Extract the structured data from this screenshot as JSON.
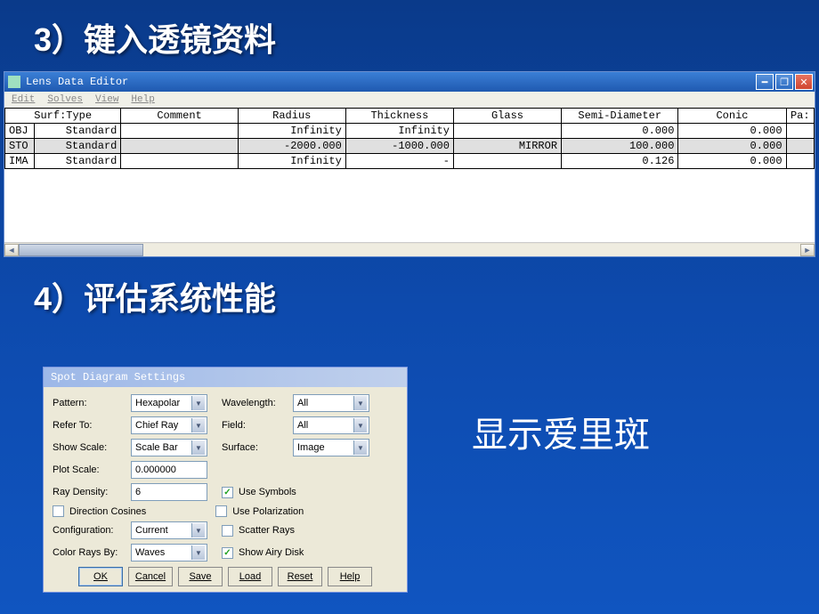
{
  "headings": {
    "h1": "3）键入透镜资料",
    "h2": "4）评估系统性能"
  },
  "lensWindow": {
    "title": "Lens Data Editor",
    "menu": [
      "Edit",
      "Solves",
      "View",
      "Help"
    ],
    "columns": [
      "Surf:Type",
      "Comment",
      "Radius",
      "Thickness",
      "Glass",
      "Semi-Diameter",
      "Conic",
      "Pa:"
    ],
    "rows": [
      {
        "id": "OBJ",
        "type": "Standard",
        "comment": "",
        "radius": "Infinity",
        "thickness": "Infinity",
        "glass": "",
        "semid": "0.000",
        "conic": "0.000"
      },
      {
        "id": "STO",
        "type": "Standard",
        "comment": "",
        "radius": "-2000.000",
        "thickness": "-1000.000",
        "glass": "MIRROR",
        "semid": "100.000",
        "conic": "0.000"
      },
      {
        "id": "IMA",
        "type": "Standard",
        "comment": "",
        "radius": "Infinity",
        "thickness": "-",
        "glass": "",
        "semid": "0.126",
        "conic": "0.000"
      }
    ]
  },
  "dialog": {
    "title": "Spot Diagram Settings",
    "labels": {
      "pattern": "Pattern:",
      "referTo": "Refer To:",
      "showScale": "Show Scale:",
      "plotScale": "Plot Scale:",
      "rayDensity": "Ray Density:",
      "wavelength": "Wavelength:",
      "field": "Field:",
      "surface": "Surface:",
      "configuration": "Configuration:",
      "colorRaysBy": "Color Rays By:"
    },
    "values": {
      "pattern": "Hexapolar",
      "referTo": "Chief Ray",
      "showScale": "Scale Bar",
      "plotScale": "0.000000",
      "rayDensity": "6",
      "wavelength": "All",
      "field": "All",
      "surface": "Image",
      "configuration": "Current",
      "colorRaysBy": "Waves"
    },
    "checks": {
      "dirCos": {
        "label": "Direction Cosines",
        "checked": false
      },
      "useSym": {
        "label": "Use Symbols",
        "checked": true
      },
      "usePol": {
        "label": "Use Polarization",
        "checked": false
      },
      "scatter": {
        "label": "Scatter Rays",
        "checked": false
      },
      "airy": {
        "label": "Show Airy Disk",
        "checked": true
      }
    },
    "buttons": [
      "OK",
      "Cancel",
      "Save",
      "Load",
      "Reset",
      "Help"
    ]
  },
  "sideText": "显示爱里斑"
}
